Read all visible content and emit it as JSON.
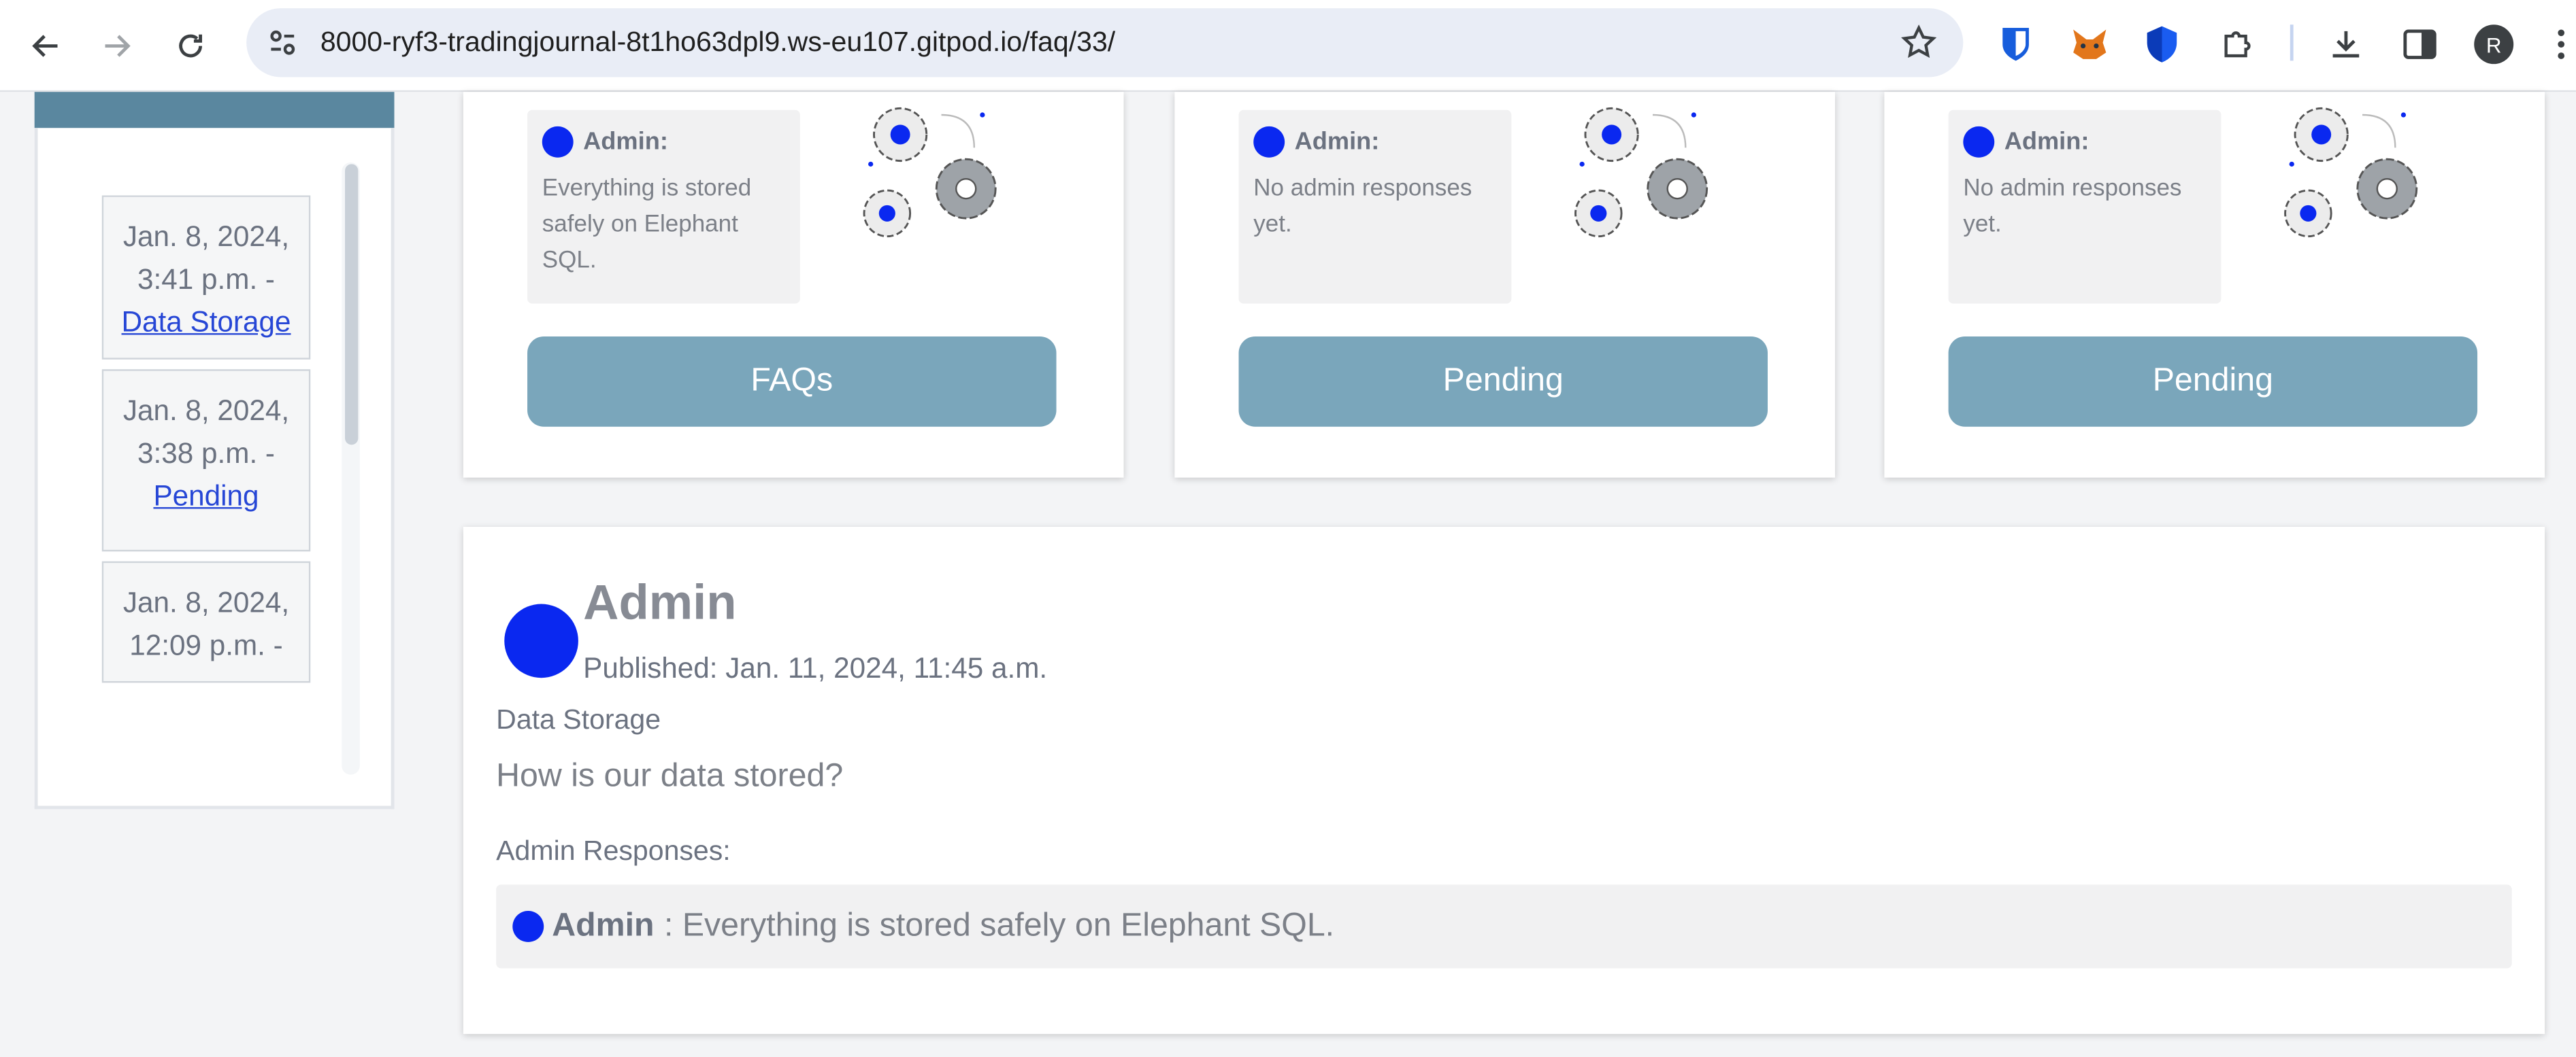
{
  "browser": {
    "url": "8000-ryf3-tradingjournal-8t1ho63dpl9.ws-eu107.gitpod.io/faq/33/",
    "profile_initial": "R",
    "icons": [
      "back-icon",
      "forward-icon",
      "reload-icon",
      "site-info-icon",
      "star-icon",
      "bitwarden-icon",
      "metamask-icon",
      "shield-icon",
      "extensions-icon",
      "download-icon",
      "side-panel-icon",
      "kebab-menu-icon"
    ]
  },
  "sidebar": {
    "items": [
      {
        "text": "Jan. 8, 2024, 3:41 p.m. -",
        "link": "Data Storage"
      },
      {
        "text": "Jan. 8, 2024, 3:38 p.m. -",
        "link": "Pending"
      },
      {
        "text": "Jan. 8, 2024, 12:09 p.m. -",
        "link": ""
      }
    ]
  },
  "cards": [
    {
      "admin_label": "Admin:",
      "response": "Everything is stored safely on Elephant SQL.",
      "button": "FAQs"
    },
    {
      "admin_label": "Admin:",
      "response": "No admin responses yet.",
      "button": "Pending"
    },
    {
      "admin_label": "Admin:",
      "response": "No admin responses yet.",
      "button": "Pending"
    }
  ],
  "detail": {
    "author": "Admin",
    "published": "Published: Jan. 11, 2024, 11:45 a.m.",
    "category": "Data Storage",
    "question": "How is our data stored?",
    "responses_label": "Admin Responses:",
    "response_author": "Admin",
    "response_text": ": Everything is stored safely on Elephant SQL."
  },
  "colors": {
    "accent_blue": "#0a28f0",
    "button": "#7aa6bb",
    "sidebar_header": "#5a879f",
    "link": "#2747d6"
  }
}
